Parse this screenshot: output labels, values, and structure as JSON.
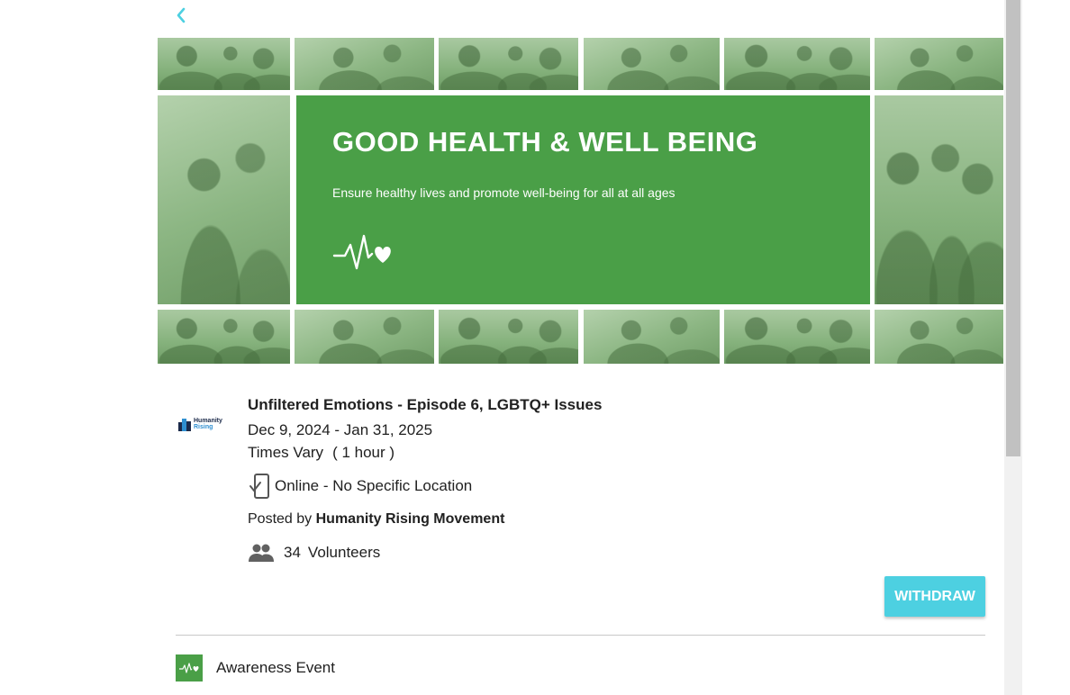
{
  "navigation": {
    "back_icon": "chevron-left-icon"
  },
  "banner": {
    "title": "GOOD HEALTH & WELL BEING",
    "subtitle": "Ensure healthy lives and promote well-being for all at all ages",
    "icon": "heartbeat-heart-icon",
    "panel_color": "#4a9f47"
  },
  "organization_logo": {
    "line1": "Humanity",
    "line2": "Rising"
  },
  "event": {
    "title": "Unfiltered Emotions - Episode 6, LGBTQ+ Issues",
    "dates": "Dec 9, 2024 - Jan 31, 2025",
    "times": "Times Vary",
    "duration": "( 1 hour )",
    "location": "Online - No Specific Location",
    "posted_by_prefix": "Posted by",
    "posted_by_name": "Humanity Rising Movement",
    "volunteer_count": "34",
    "volunteer_label": "Volunteers"
  },
  "actions": {
    "withdraw_label": "WITHDRAW",
    "accent_color": "#4dd0e1"
  },
  "category": {
    "label": "Awareness Event",
    "icon": "heartbeat-heart-icon"
  }
}
